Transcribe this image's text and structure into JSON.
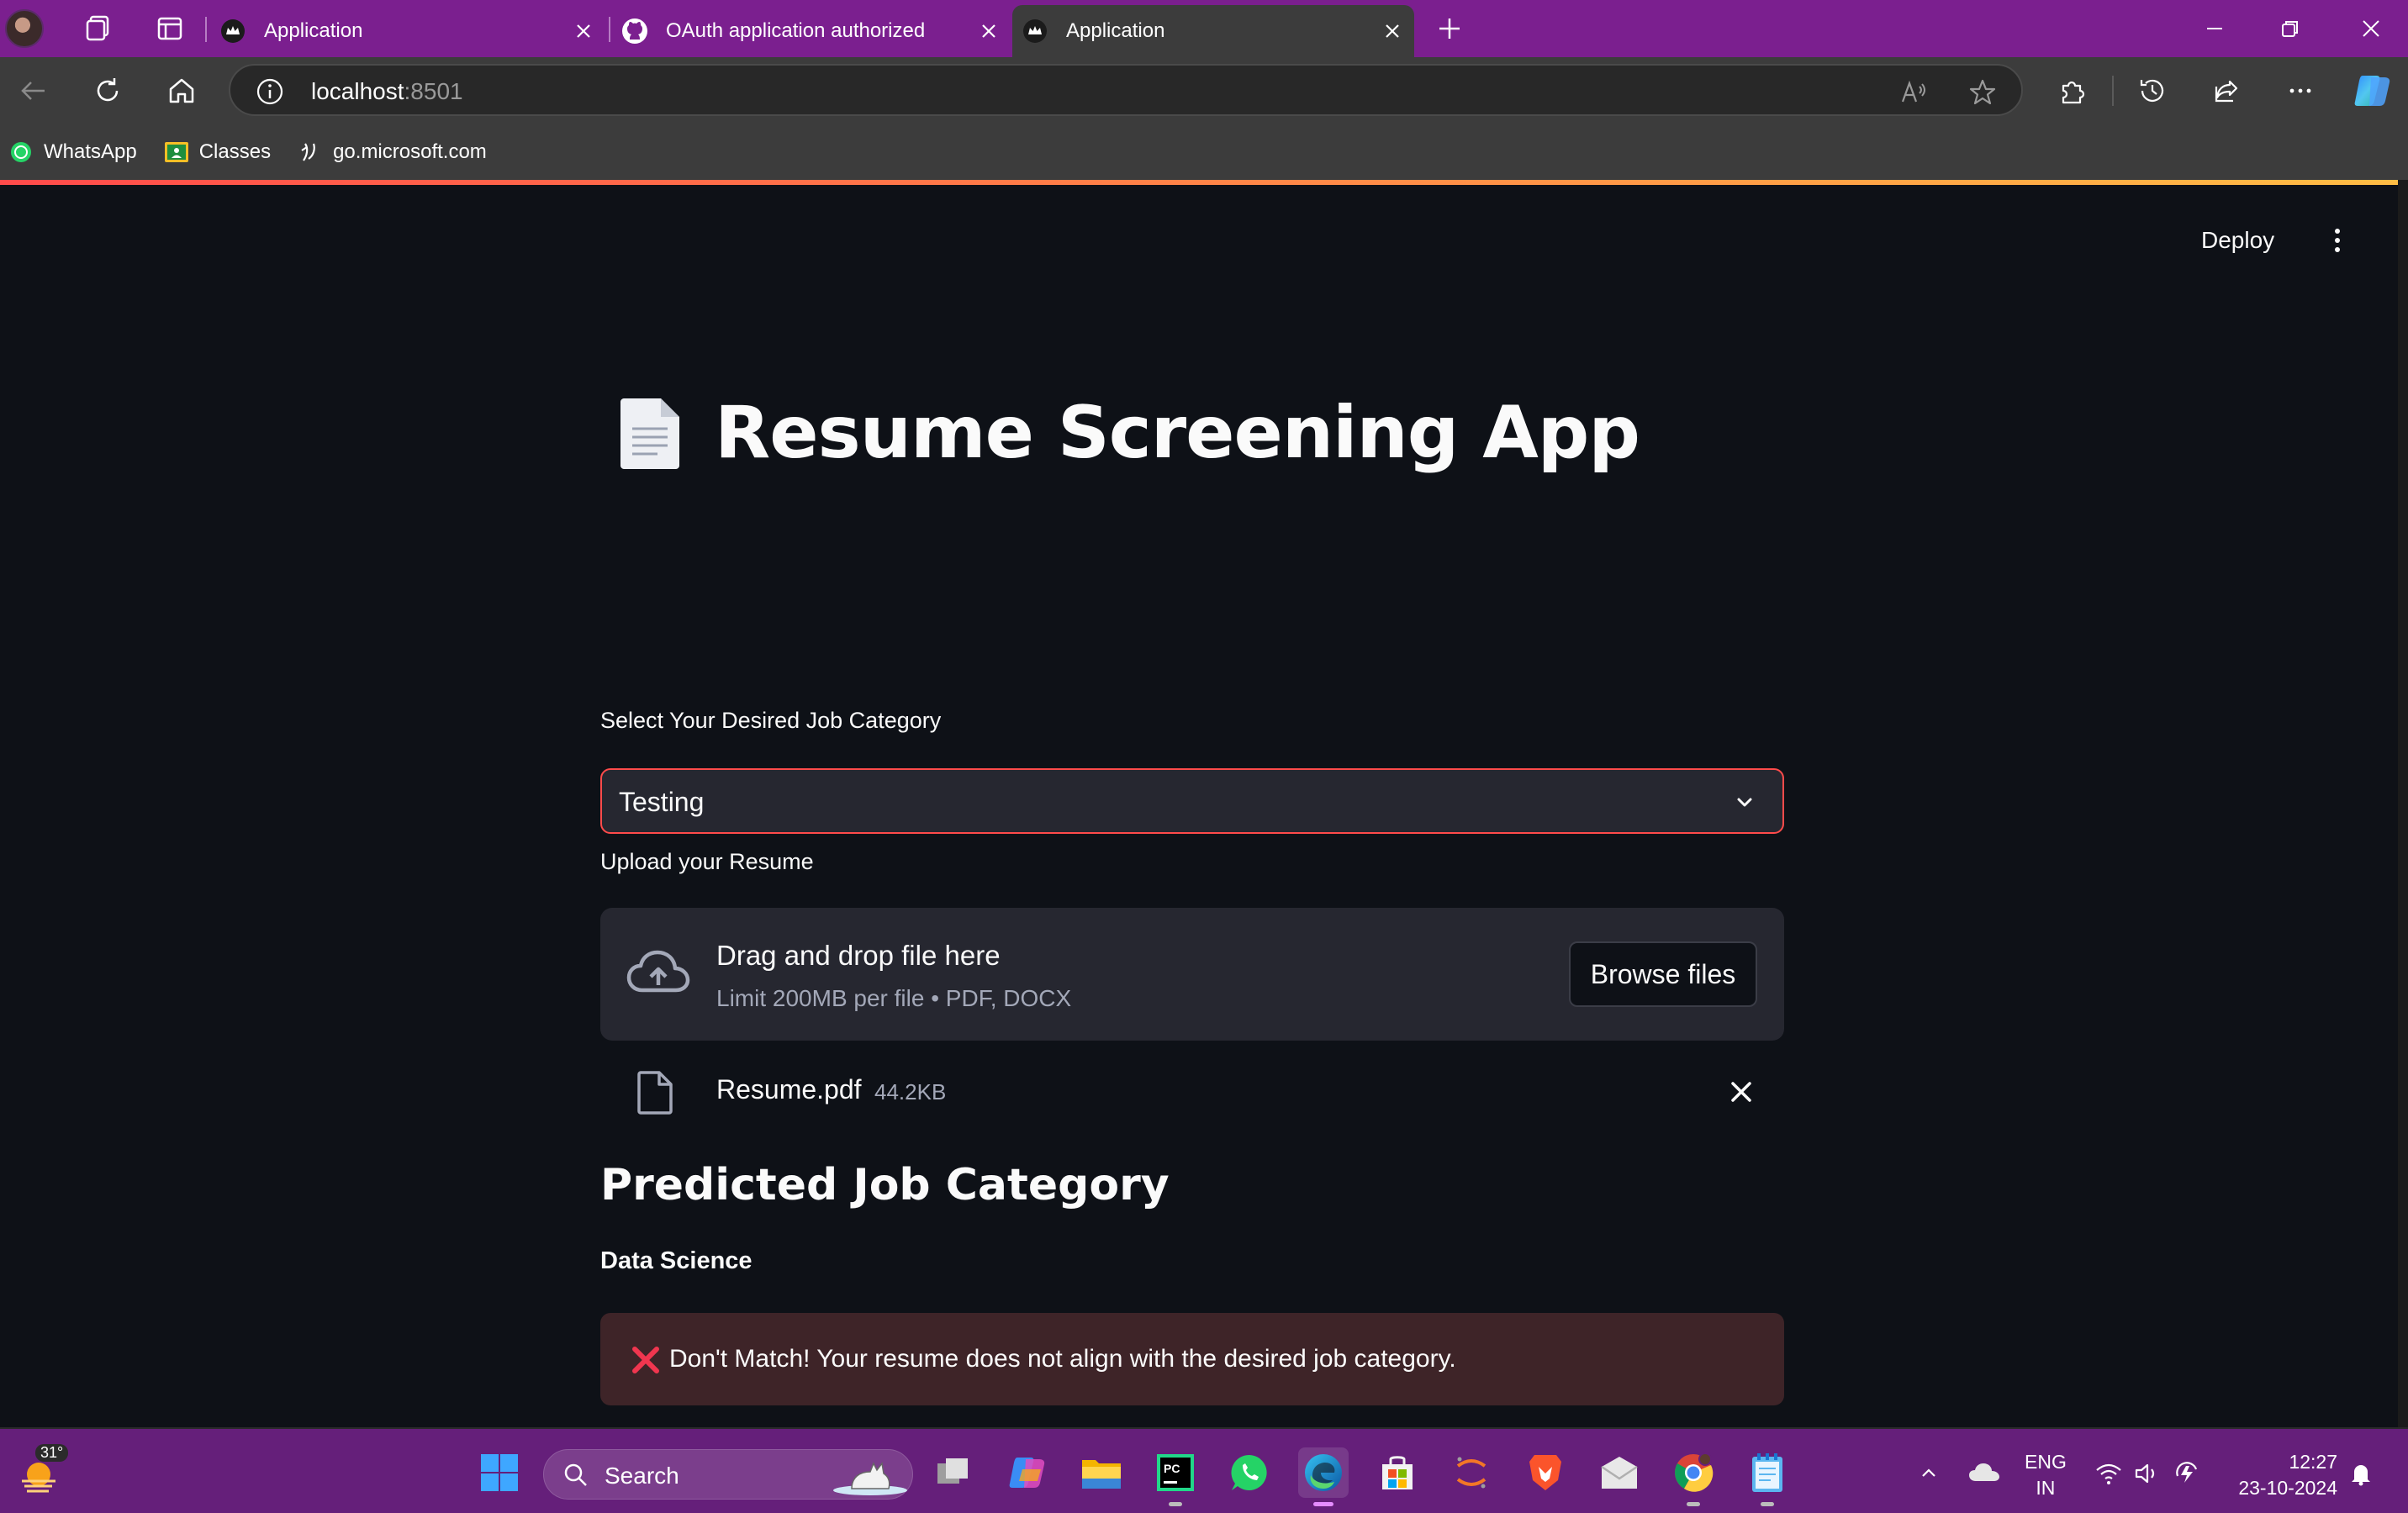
{
  "browser": {
    "tabs": [
      {
        "title": "Application"
      },
      {
        "title": "OAuth application authorized"
      },
      {
        "title": "Application"
      }
    ],
    "address": {
      "host": "localhost",
      "port": ":8501"
    },
    "bookmarks": [
      {
        "label": "WhatsApp"
      },
      {
        "label": "Classes"
      },
      {
        "label": "go.microsoft.com"
      }
    ]
  },
  "app": {
    "header": {
      "deploy_label": "Deploy"
    },
    "title": "Resume Screening App",
    "category_label": "Select Your Desired Job Category",
    "category_value": "Testing",
    "upload_label": "Upload your Resume",
    "dropzone": {
      "main": "Drag and drop file here",
      "sub": "Limit 200MB per file • PDF, DOCX",
      "browse_label": "Browse files"
    },
    "file": {
      "name": "Resume.pdf",
      "size": "44.2KB"
    },
    "predicted_heading": "Predicted Job Category",
    "predicted_value": "Data Science",
    "alert": {
      "text": "Don't Match! Your resume does not align with the desired job category."
    }
  },
  "taskbar": {
    "weather_temp": "31°",
    "search_placeholder": "Search",
    "language": {
      "line1": "ENG",
      "line2": "IN"
    },
    "clock": {
      "time": "12:27",
      "date": "23-10-2024"
    }
  },
  "colors": {
    "tabstrip": "#7b1f8f",
    "app_bg": "#0e1117",
    "accent_red": "#ff4b4b",
    "alert_bg": "#3e2428",
    "taskbar": "#651f7a"
  }
}
